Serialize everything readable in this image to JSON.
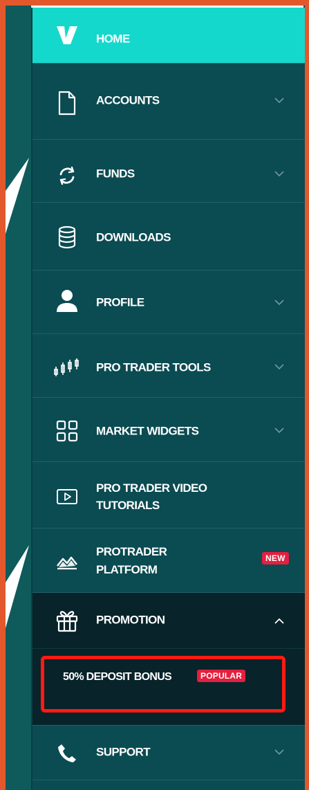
{
  "sidebar": {
    "items": [
      {
        "label": "HOME",
        "icon": "brand-logo-icon"
      },
      {
        "label": "ACCOUNTS",
        "icon": "document-icon"
      },
      {
        "label": "FUNDS",
        "icon": "refresh-icon"
      },
      {
        "label": "DOWNLOADS",
        "icon": "database-icon"
      },
      {
        "label": "PROFILE",
        "icon": "user-icon"
      },
      {
        "label": "PRO TRADER TOOLS",
        "icon": "candlestick-icon"
      },
      {
        "label": "MARKET WIDGETS",
        "icon": "grid-icon"
      },
      {
        "label_line1": "PRO TRADER VIDEO",
        "label_line2": "TUTORIALS",
        "icon": "video-play-icon"
      },
      {
        "label_line1": "PROTRADER",
        "label_line2": "PLATFORM",
        "icon": "mountain-icon",
        "badge": "NEW"
      },
      {
        "label": "PROMOTION",
        "icon": "gift-icon"
      },
      {
        "label": "SUPPORT",
        "icon": "phone-icon"
      }
    ],
    "promotion_sub": {
      "label": "50% DEPOSIT BONUS",
      "badge": "POPULAR"
    }
  },
  "colors": {
    "frame": "#e2582c",
    "sidebar": "#0b4b52",
    "home_active": "#14d8cb",
    "promotion_bg": "#08232a",
    "badge": "#e41f3f",
    "highlight": "#ff1a12"
  }
}
